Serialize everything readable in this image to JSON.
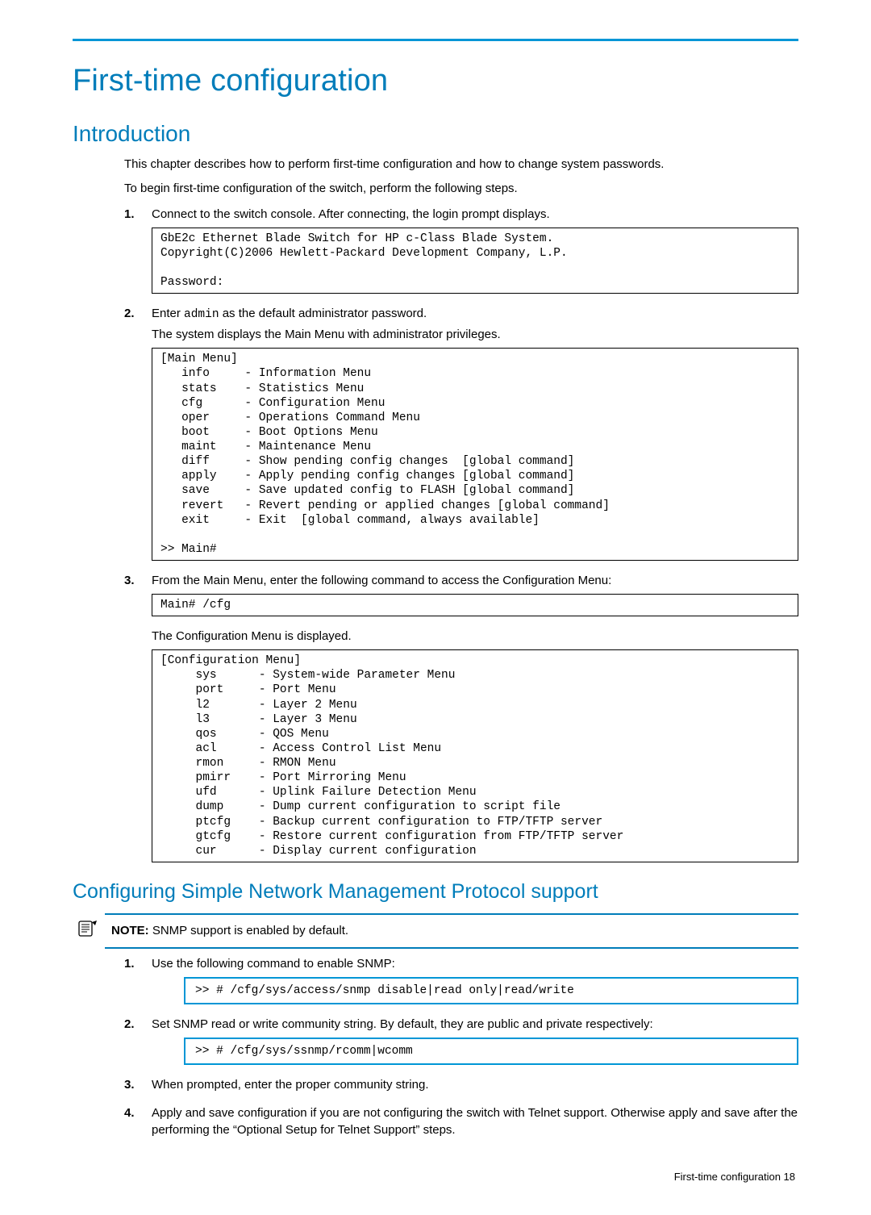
{
  "header": {
    "title": "First-time configuration"
  },
  "intro": {
    "heading": "Introduction",
    "p1": "This chapter describes how to perform first-time configuration and how to change system passwords.",
    "p2": "To begin first-time configuration of the switch, perform the following steps.",
    "steps": {
      "s1": {
        "num": "1.",
        "text": "Connect to the switch console. After connecting, the login prompt displays.",
        "code": "GbE2c Ethernet Blade Switch for HP c-Class Blade System.\nCopyright(C)2006 Hewlett-Packard Development Company, L.P.\n\nPassword:"
      },
      "s2": {
        "num": "2.",
        "pre": "Enter ",
        "mono": "admin",
        "post": " as the default administrator password.",
        "line2": "The system displays the Main Menu with administrator privileges.",
        "code": "[Main Menu]\n   info     - Information Menu\n   stats    - Statistics Menu\n   cfg      - Configuration Menu\n   oper     - Operations Command Menu\n   boot     - Boot Options Menu\n   maint    - Maintenance Menu\n   diff     - Show pending config changes  [global command]\n   apply    - Apply pending config changes [global command]\n   save     - Save updated config to FLASH [global command]\n   revert   - Revert pending or applied changes [global command]\n   exit     - Exit  [global command, always available]\n\n>> Main#"
      },
      "s3": {
        "num": "3.",
        "text": "From the Main Menu, enter the following command to access the Configuration Menu:",
        "code1": "Main# /cfg",
        "line2": "The Configuration Menu is displayed.",
        "code2": "[Configuration Menu]\n     sys      - System-wide Parameter Menu\n     port     - Port Menu\n     l2       - Layer 2 Menu\n     l3       - Layer 3 Menu\n     qos      - QOS Menu\n     acl      - Access Control List Menu\n     rmon     - RMON Menu\n     pmirr    - Port Mirroring Menu\n     ufd      - Uplink Failure Detection Menu\n     dump     - Dump current configuration to script file\n     ptcfg    - Backup current configuration to FTP/TFTP server\n     gtcfg    - Restore current configuration from FTP/TFTP server\n     cur      - Display current configuration"
      }
    }
  },
  "snmp": {
    "heading": "Configuring Simple Network Management Protocol support",
    "note_label": "NOTE:",
    "note_text": "  SNMP support is enabled by default.",
    "steps": {
      "s1": {
        "num": "1.",
        "text": "Use the following command to enable SNMP:",
        "code": ">> # /cfg/sys/access/snmp disable|read only|read/write"
      },
      "s2": {
        "num": "2.",
        "text": "Set SNMP read or write community string. By default, they are public and private respectively:",
        "code": ">> # /cfg/sys/ssnmp/rcomm|wcomm"
      },
      "s3": {
        "num": "3.",
        "text": "When prompted, enter the proper community string."
      },
      "s4": {
        "num": "4.",
        "text": "Apply and save configuration if you are not configuring the switch with Telnet support. Otherwise apply and save after the performing the “Optional Setup for Telnet Support” steps."
      }
    }
  },
  "footer": {
    "text": "First-time configuration   18"
  }
}
